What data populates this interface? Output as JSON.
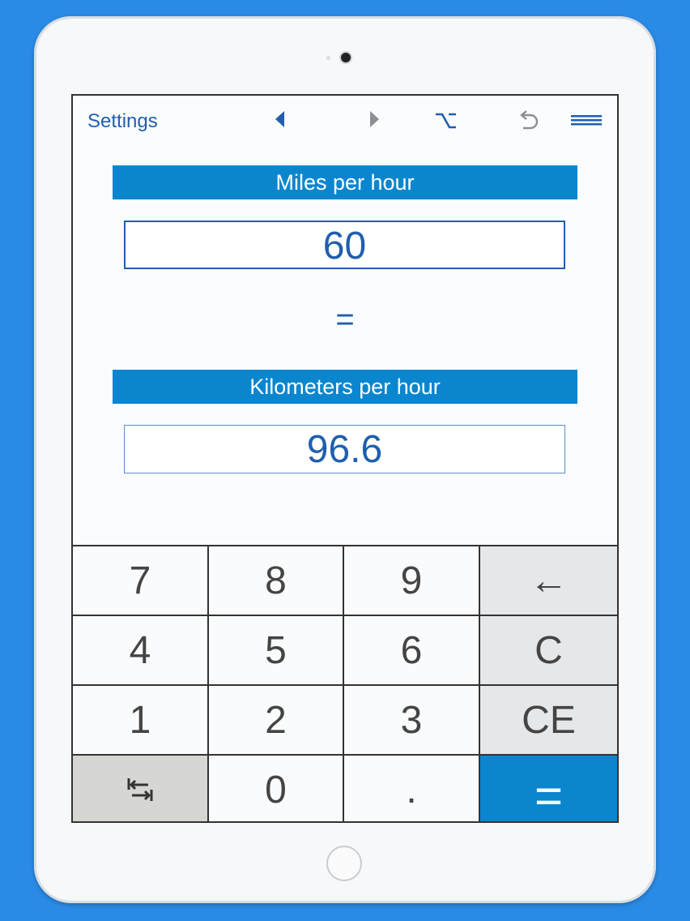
{
  "toolbar": {
    "settings_label": "Settings",
    "icons": [
      "left-arrow-icon",
      "right-arrow-icon",
      "option-key-icon",
      "undo-icon",
      "menu-icon"
    ]
  },
  "from_unit": {
    "label": "Miles per hour",
    "value": "60"
  },
  "equals": "=",
  "to_unit": {
    "label": "Kilometers per hour",
    "value": "96.6"
  },
  "keypad": {
    "keys": [
      "7",
      "8",
      "9",
      "←",
      "4",
      "5",
      "6",
      "C",
      "1",
      "2",
      "3",
      "CE",
      "0",
      ".",
      "="
    ]
  },
  "colors": {
    "background": "#2a8be6",
    "accent": "#0a86cf",
    "text_blue": "#1f5fae"
  }
}
